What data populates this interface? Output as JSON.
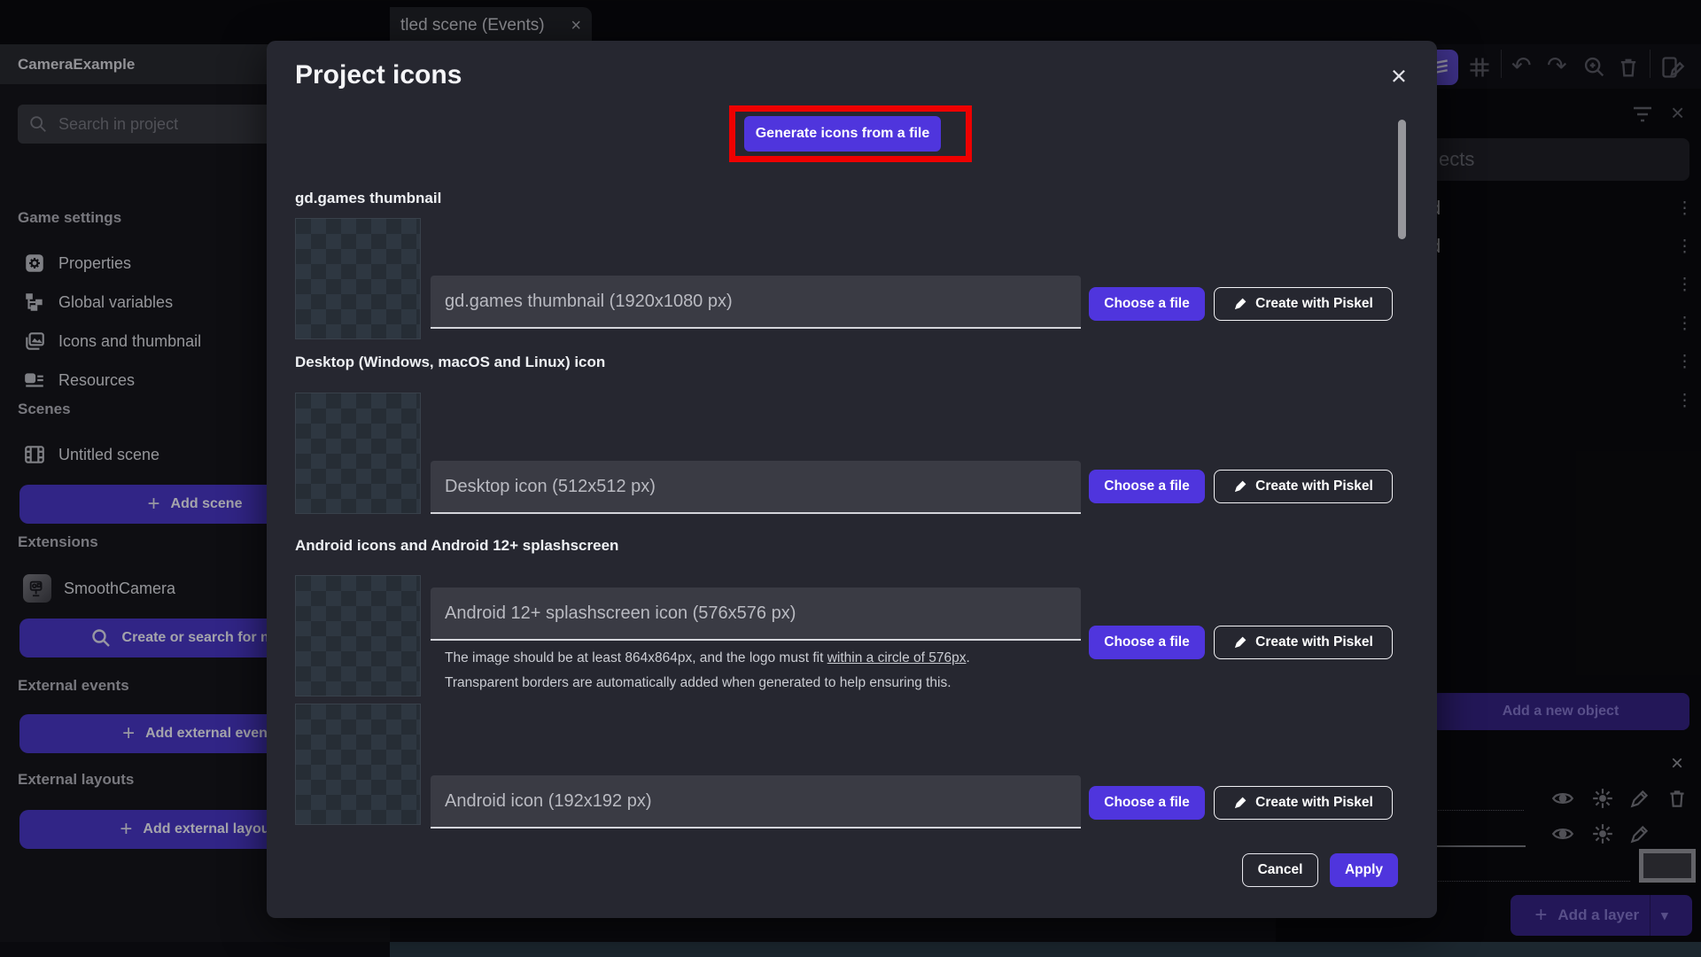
{
  "colors": {
    "accent_purple": "#4f35dd",
    "highlight_red": "#ee0000",
    "modal_bg": "#262730"
  },
  "glyphs": {
    "close": "×",
    "kebab": "⋮",
    "plus": "+",
    "arrow_down": "▾",
    "undo": "↶",
    "redo": "↷"
  },
  "topbar": {
    "tab_title": "tled scene (Events)"
  },
  "sidebar": {
    "project_title": "CameraExample",
    "search_placeholder": "Search in project",
    "headings": {
      "game_settings": "Game settings",
      "scenes": "Scenes",
      "extensions": "Extensions",
      "external_events": "External events",
      "external_layouts": "External layouts"
    },
    "items": {
      "properties": "Properties",
      "global_variables": "Global variables",
      "icons_thumbnail": "Icons and thumbnail",
      "resources": "Resources",
      "untitled_scene": "Untitled scene",
      "smooth_camera": "SmoothCamera"
    },
    "buttons": {
      "add_scene": "Add scene",
      "create_or_search_extension": "Create or search for new e",
      "add_external_event": "Add external even",
      "add_external_layout": "Add external layou"
    }
  },
  "right_panel": {
    "objects_search_text": "ects",
    "rows": [
      {
        "label": "d"
      },
      {
        "label": "d"
      }
    ],
    "add_object_label": "Add a new object",
    "add_layer_label": "Add a layer"
  },
  "modal": {
    "title": "Project icons",
    "generate_button_label": "Generate icons from a file",
    "choose_file_label": "Choose a file",
    "piskel_label": "Create with Piskel",
    "sections": [
      {
        "heading": "gd.games thumbnail",
        "placeholder": "gd.games thumbnail (1920x1080 px)"
      },
      {
        "heading": "Desktop (Windows, macOS and Linux) icon",
        "placeholder": "Desktop icon (512x512 px)"
      },
      {
        "heading": "Android icons and Android 12+ splashscreen",
        "placeholder": "Android 12+ splashscreen icon (576x576 px)",
        "help_prefix": "The image should be at least 864x864px, and the logo must fit ",
        "help_underlined": "within a circle of 576px",
        "help_suffix": ".",
        "help_line2": "Transparent borders are automatically added when generated to help ensuring this."
      },
      {
        "placeholder": "Android icon (192x192 px)"
      }
    ],
    "cancel_label": "Cancel",
    "apply_label": "Apply"
  }
}
